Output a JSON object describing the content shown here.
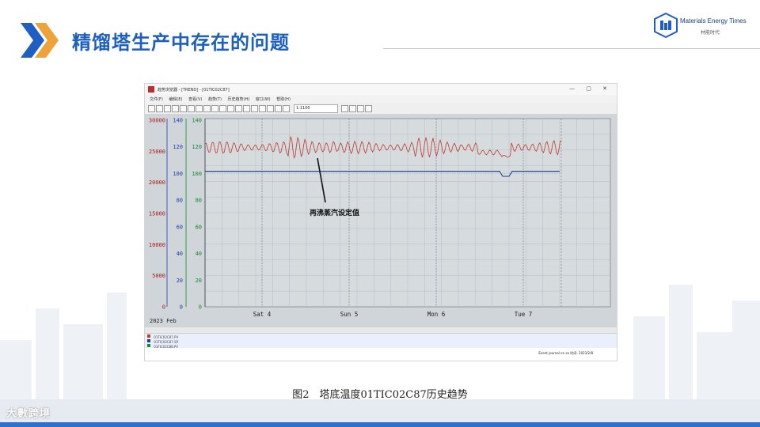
{
  "slide": {
    "title": "精馏塔生产中存在的问题",
    "brand_name": "Materials Energy Times",
    "brand_sub": "材能时代",
    "figure_caption": "图2　塔底温度01TIC02C87历史趋势",
    "watermark": "大數跨境"
  },
  "app_window": {
    "title": "趋势浏览器 - [TREND] - [01TIC02C87]",
    "menu": [
      "文件(F)",
      "编辑(E)",
      "查看(V)",
      "趋势(T)",
      "历史趋势(H)",
      "窗口(W)",
      "帮助(H)"
    ],
    "toolbar_combo_value": "1:1100",
    "status_text": "Event journal on xx   时间: 2023/2/8"
  },
  "trend": {
    "year_month": "2023 Feb",
    "annotation": "再沸蒸汽设定值",
    "day_labels": [
      "Sat 4",
      "Sun 5",
      "Mon 6",
      "Tue 7"
    ],
    "axis_flow_ticks": [
      "30000",
      "25000",
      "20000",
      "15000",
      "10000",
      "5000",
      "0"
    ],
    "axis_blue_ticks": [
      "140",
      "120",
      "100",
      "80",
      "60",
      "40",
      "20",
      "0"
    ],
    "axis_green_ticks": [
      "140",
      "120",
      "100",
      "80",
      "60",
      "40",
      "20",
      "0"
    ],
    "colors": {
      "temperature": "#c0392b",
      "setpoint": "#1f3f8f",
      "flow_axis": "#a61c1c",
      "blue_axis": "#1f3fb0",
      "green_axis": "#1a8a2a"
    }
  },
  "legend_rows": [
    {
      "tag": "01TIC02C87.PV",
      "color": "#c0392b"
    },
    {
      "tag": "01TIC02C87.SP",
      "color": "#1f3f8f"
    },
    {
      "tag": "01FIC02C88.PV",
      "color": "#1a8a2a"
    }
  ]
}
